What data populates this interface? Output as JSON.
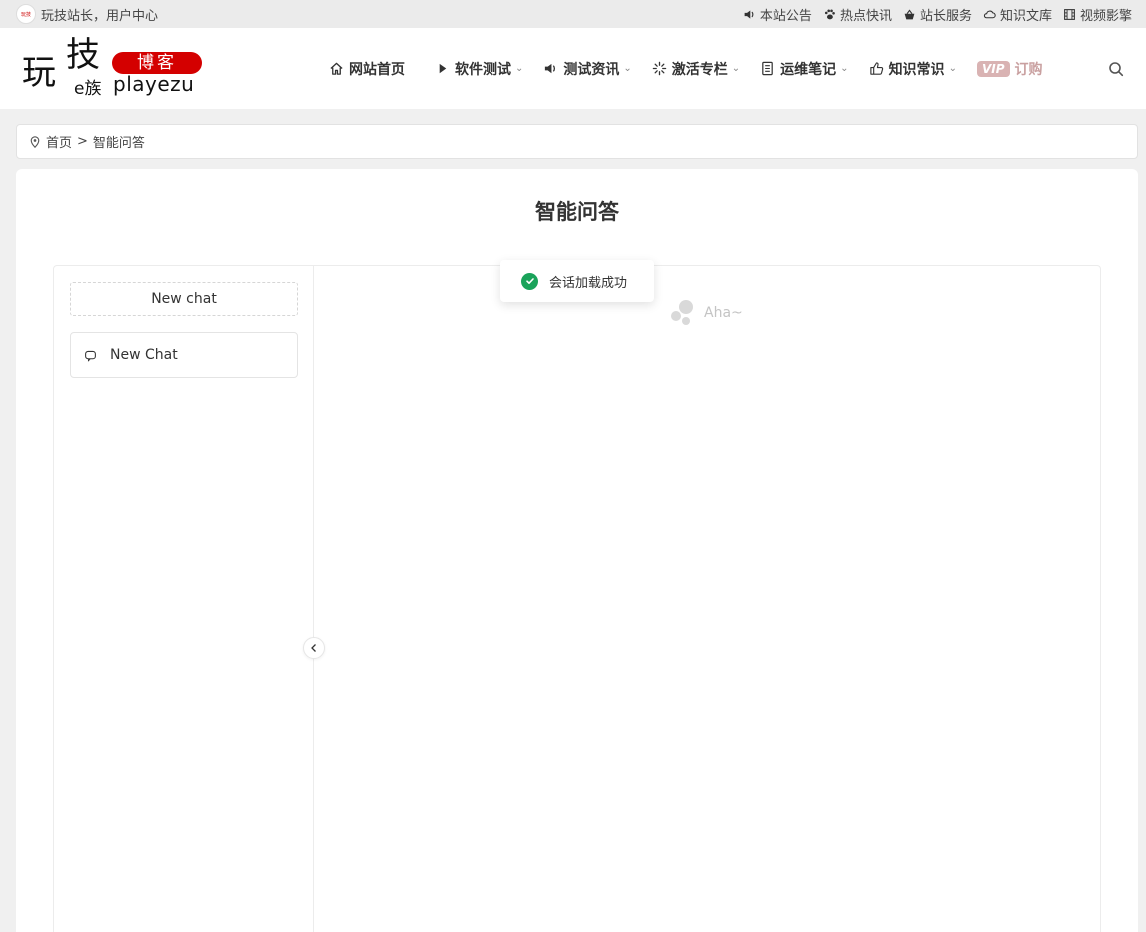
{
  "topbar": {
    "greeting": "玩技站长，用户中心",
    "links": [
      {
        "label": "本站公告",
        "icon": "speaker-icon"
      },
      {
        "label": "热点快讯",
        "icon": "paw-icon"
      },
      {
        "label": "站长服务",
        "icon": "basket-icon"
      },
      {
        "label": "知识文库",
        "icon": "cloud-icon"
      },
      {
        "label": "视频影擎",
        "icon": "film-icon"
      }
    ]
  },
  "logo": {
    "char1": "玩",
    "char2": "技",
    "badge": "博客",
    "small": "e族",
    "latin": "playezu"
  },
  "nav": {
    "items": [
      {
        "label": "网站首页",
        "icon": "home-icon"
      },
      {
        "label": "软件测试",
        "icon": "play-icon"
      },
      {
        "label": "测试资讯",
        "icon": "speaker-icon"
      },
      {
        "label": "激活专栏",
        "icon": "loader-icon"
      },
      {
        "label": "运维笔记",
        "icon": "document-icon"
      },
      {
        "label": "知识常识",
        "icon": "thumbs-up-icon"
      }
    ],
    "vip_badge": "VIP",
    "vip_label": "订购"
  },
  "breadcrumb": {
    "home": "首页",
    "separator": ">",
    "current": "智能问答"
  },
  "page": {
    "title": "智能问答"
  },
  "chat": {
    "new_chat_button": "New chat",
    "sessions": [
      {
        "label": "New Chat"
      }
    ],
    "placeholder": "Aha~"
  },
  "toast": {
    "message": "会话加载成功"
  },
  "colors": {
    "brand_red": "#d40000",
    "success_green": "#1aa35a"
  }
}
